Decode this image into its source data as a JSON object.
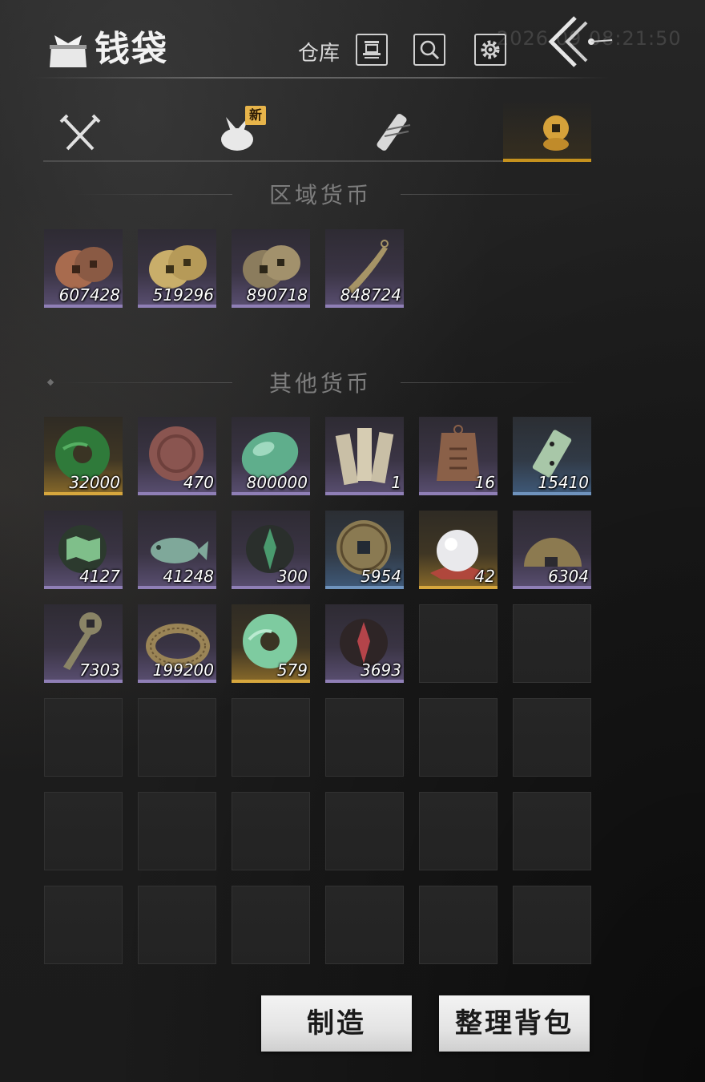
{
  "header": {
    "title": "钱袋",
    "clock": "2026 09 08:21:50",
    "warehouse_label": "仓库"
  },
  "tabs": [
    {
      "id": "weapons",
      "icon": "crossed-swords-icon"
    },
    {
      "id": "bundle",
      "icon": "bundle-icon",
      "badge": "新"
    },
    {
      "id": "scroll",
      "icon": "scroll-icon"
    },
    {
      "id": "currency",
      "icon": "coins-icon",
      "active": true
    }
  ],
  "regional": {
    "title": "区域货币",
    "items": [
      {
        "icon": "copper-coins-icon",
        "count": "607428",
        "rarity": "purple"
      },
      {
        "icon": "gold-coins-icon",
        "count": "519296",
        "rarity": "purple"
      },
      {
        "icon": "bronze-coins-icon",
        "count": "890718",
        "rarity": "purple"
      },
      {
        "icon": "knife-money-icon",
        "count": "848724",
        "rarity": "purple"
      }
    ]
  },
  "other": {
    "title": "其他货币",
    "items": [
      {
        "icon": "jade-disc-icon",
        "count": "32000",
        "rarity": "gold"
      },
      {
        "icon": "red-stone-icon",
        "count": "470",
        "rarity": "purple"
      },
      {
        "icon": "jade-pebble-icon",
        "count": "800000",
        "rarity": "purple"
      },
      {
        "icon": "bamboo-slips-icon",
        "count": "1",
        "rarity": "purple"
      },
      {
        "icon": "bronze-tablet-icon",
        "count": "16",
        "rarity": "purple"
      },
      {
        "icon": "jade-token-icon",
        "count": "15410",
        "rarity": "blue"
      },
      {
        "icon": "jade-map-icon",
        "count": "4127",
        "rarity": "purple"
      },
      {
        "icon": "jade-fish-icon",
        "count": "41248",
        "rarity": "purple"
      },
      {
        "icon": "green-sigil-icon",
        "count": "300",
        "rarity": "purple"
      },
      {
        "icon": "square-hole-coin-icon",
        "count": "5954",
        "rarity": "blue"
      },
      {
        "icon": "pearl-icon",
        "count": "42",
        "rarity": "gold"
      },
      {
        "icon": "half-coin-icon",
        "count": "6304",
        "rarity": "purple"
      },
      {
        "icon": "key-coin-icon",
        "count": "7303",
        "rarity": "purple"
      },
      {
        "icon": "coin-string-icon",
        "count": "199200",
        "rarity": "purple"
      },
      {
        "icon": "jade-ring-icon",
        "count": "579",
        "rarity": "gold"
      },
      {
        "icon": "red-sigil-icon",
        "count": "3693",
        "rarity": "purple"
      }
    ]
  },
  "buttons": {
    "craft": "制造",
    "organize": "整理背包"
  }
}
